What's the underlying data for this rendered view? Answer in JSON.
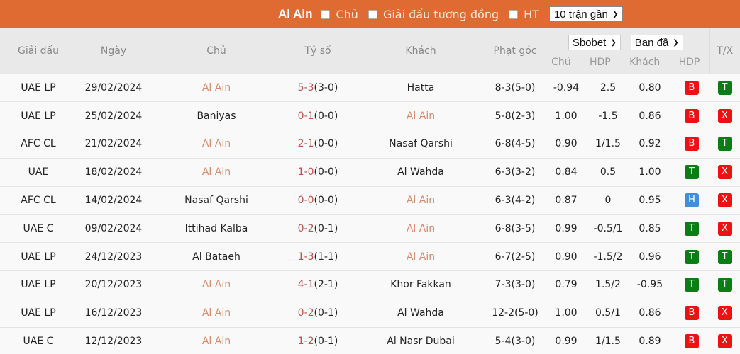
{
  "topbar": {
    "team": "Al Ain",
    "filters": [
      {
        "label": "Chủ",
        "checked": false
      },
      {
        "label": "Giải đấu tương đồng",
        "checked": false
      },
      {
        "label": "HT",
        "checked": false
      }
    ],
    "range_select": "10 trận gần",
    "background_color": "#df6a32"
  },
  "table": {
    "headers": {
      "league": "Giải đấu",
      "date": "Ngày",
      "home": "Chủ",
      "score": "Tỷ số",
      "away": "Khách",
      "corners": "Phạt góc",
      "bookmaker_select": "Sbobet",
      "odds_type_select": "Ban đầ",
      "odds_home": "Chủ",
      "odds_hdp": "HDP",
      "odds_away": "Khách",
      "result_hdp": "HDP",
      "result_tx": "T/X"
    },
    "rows": [
      {
        "league": "UAE LP",
        "date": "29/02/2024",
        "home": "Al Ain",
        "home_is_team": true,
        "score_ft": "5-3",
        "score_ht": "(3-0)",
        "away": "Hatta",
        "away_is_team": false,
        "corners": "8-3(5-0)",
        "o_home": "-0.94",
        "o_hdp": "2.5",
        "o_away": "0.80",
        "hdp": "B",
        "tx": "T"
      },
      {
        "league": "UAE LP",
        "date": "25/02/2024",
        "home": "Baniyas",
        "home_is_team": false,
        "score_ft": "0-1",
        "score_ht": "(0-0)",
        "away": "Al Ain",
        "away_is_team": true,
        "corners": "5-8(2-3)",
        "o_home": "1.00",
        "o_hdp": "-1.5",
        "o_away": "0.86",
        "hdp": "B",
        "tx": "X"
      },
      {
        "league": "AFC CL",
        "date": "21/02/2024",
        "home": "Al Ain",
        "home_is_team": true,
        "score_ft": "2-1",
        "score_ht": "(0-0)",
        "away": "Nasaf Qarshi",
        "away_is_team": false,
        "corners": "6-8(4-5)",
        "o_home": "0.90",
        "o_hdp": "1/1.5",
        "o_away": "0.92",
        "hdp": "B",
        "tx": "T"
      },
      {
        "league": "UAE",
        "date": "18/02/2024",
        "home": "Al Ain",
        "home_is_team": true,
        "score_ft": "1-0",
        "score_ht": "(0-0)",
        "away": "Al Wahda",
        "away_is_team": false,
        "corners": "6-3(3-2)",
        "o_home": "0.84",
        "o_hdp": "0.5",
        "o_away": "1.00",
        "hdp": "T",
        "tx": "X"
      },
      {
        "league": "AFC CL",
        "date": "14/02/2024",
        "home": "Nasaf Qarshi",
        "home_is_team": false,
        "score_ft": "0-0",
        "score_ht": "(0-0)",
        "away": "Al Ain",
        "away_is_team": true,
        "corners": "6-3(4-2)",
        "o_home": "0.87",
        "o_hdp": "0",
        "o_away": "0.95",
        "hdp": "H",
        "tx": "X"
      },
      {
        "league": "UAE C",
        "date": "09/02/2024",
        "home": "Ittihad Kalba",
        "home_is_team": false,
        "score_ft": "0-2",
        "score_ht": "(0-1)",
        "away": "Al Ain",
        "away_is_team": true,
        "corners": "6-8(3-5)",
        "o_home": "0.99",
        "o_hdp": "-0.5/1",
        "o_away": "0.85",
        "hdp": "T",
        "tx": "X"
      },
      {
        "league": "UAE LP",
        "date": "24/12/2023",
        "home": "Al Bataeh",
        "home_is_team": false,
        "score_ft": "1-3",
        "score_ht": "(1-1)",
        "away": "Al Ain",
        "away_is_team": true,
        "corners": "6-7(2-5)",
        "o_home": "0.90",
        "o_hdp": "-1.5/2",
        "o_away": "0.96",
        "hdp": "T",
        "tx": "T"
      },
      {
        "league": "UAE LP",
        "date": "20/12/2023",
        "home": "Al Ain",
        "home_is_team": true,
        "score_ft": "4-1",
        "score_ht": "(2-1)",
        "away": "Khor Fakkan",
        "away_is_team": false,
        "corners": "7-3(3-0)",
        "o_home": "0.79",
        "o_hdp": "1.5/2",
        "o_away": "-0.95",
        "hdp": "T",
        "tx": "T"
      },
      {
        "league": "UAE LP",
        "date": "16/12/2023",
        "home": "Al Ain",
        "home_is_team": true,
        "score_ft": "0-2",
        "score_ht": "(0-1)",
        "away": "Al Wahda",
        "away_is_team": false,
        "corners": "12-2(5-0)",
        "o_home": "1.00",
        "o_hdp": "0.5/1",
        "o_away": "0.86",
        "hdp": "B",
        "tx": "X"
      },
      {
        "league": "UAE C",
        "date": "12/12/2023",
        "home": "Al Ain",
        "home_is_team": true,
        "score_ft": "1-2",
        "score_ht": "(0-1)",
        "away": "Al Nasr Dubai",
        "away_is_team": false,
        "corners": "5-4(3-0)",
        "o_home": "0.99",
        "o_hdp": "1/1.5",
        "o_away": "0.89",
        "hdp": "B",
        "tx": "X"
      }
    ],
    "badge_colors": {
      "B": "#ee1111",
      "X": "#ee1111",
      "T": "#0a7d15",
      "H": "#3f8ee0"
    },
    "team_highlight_color": "#d98a6a",
    "score_color": "#c0504d"
  }
}
